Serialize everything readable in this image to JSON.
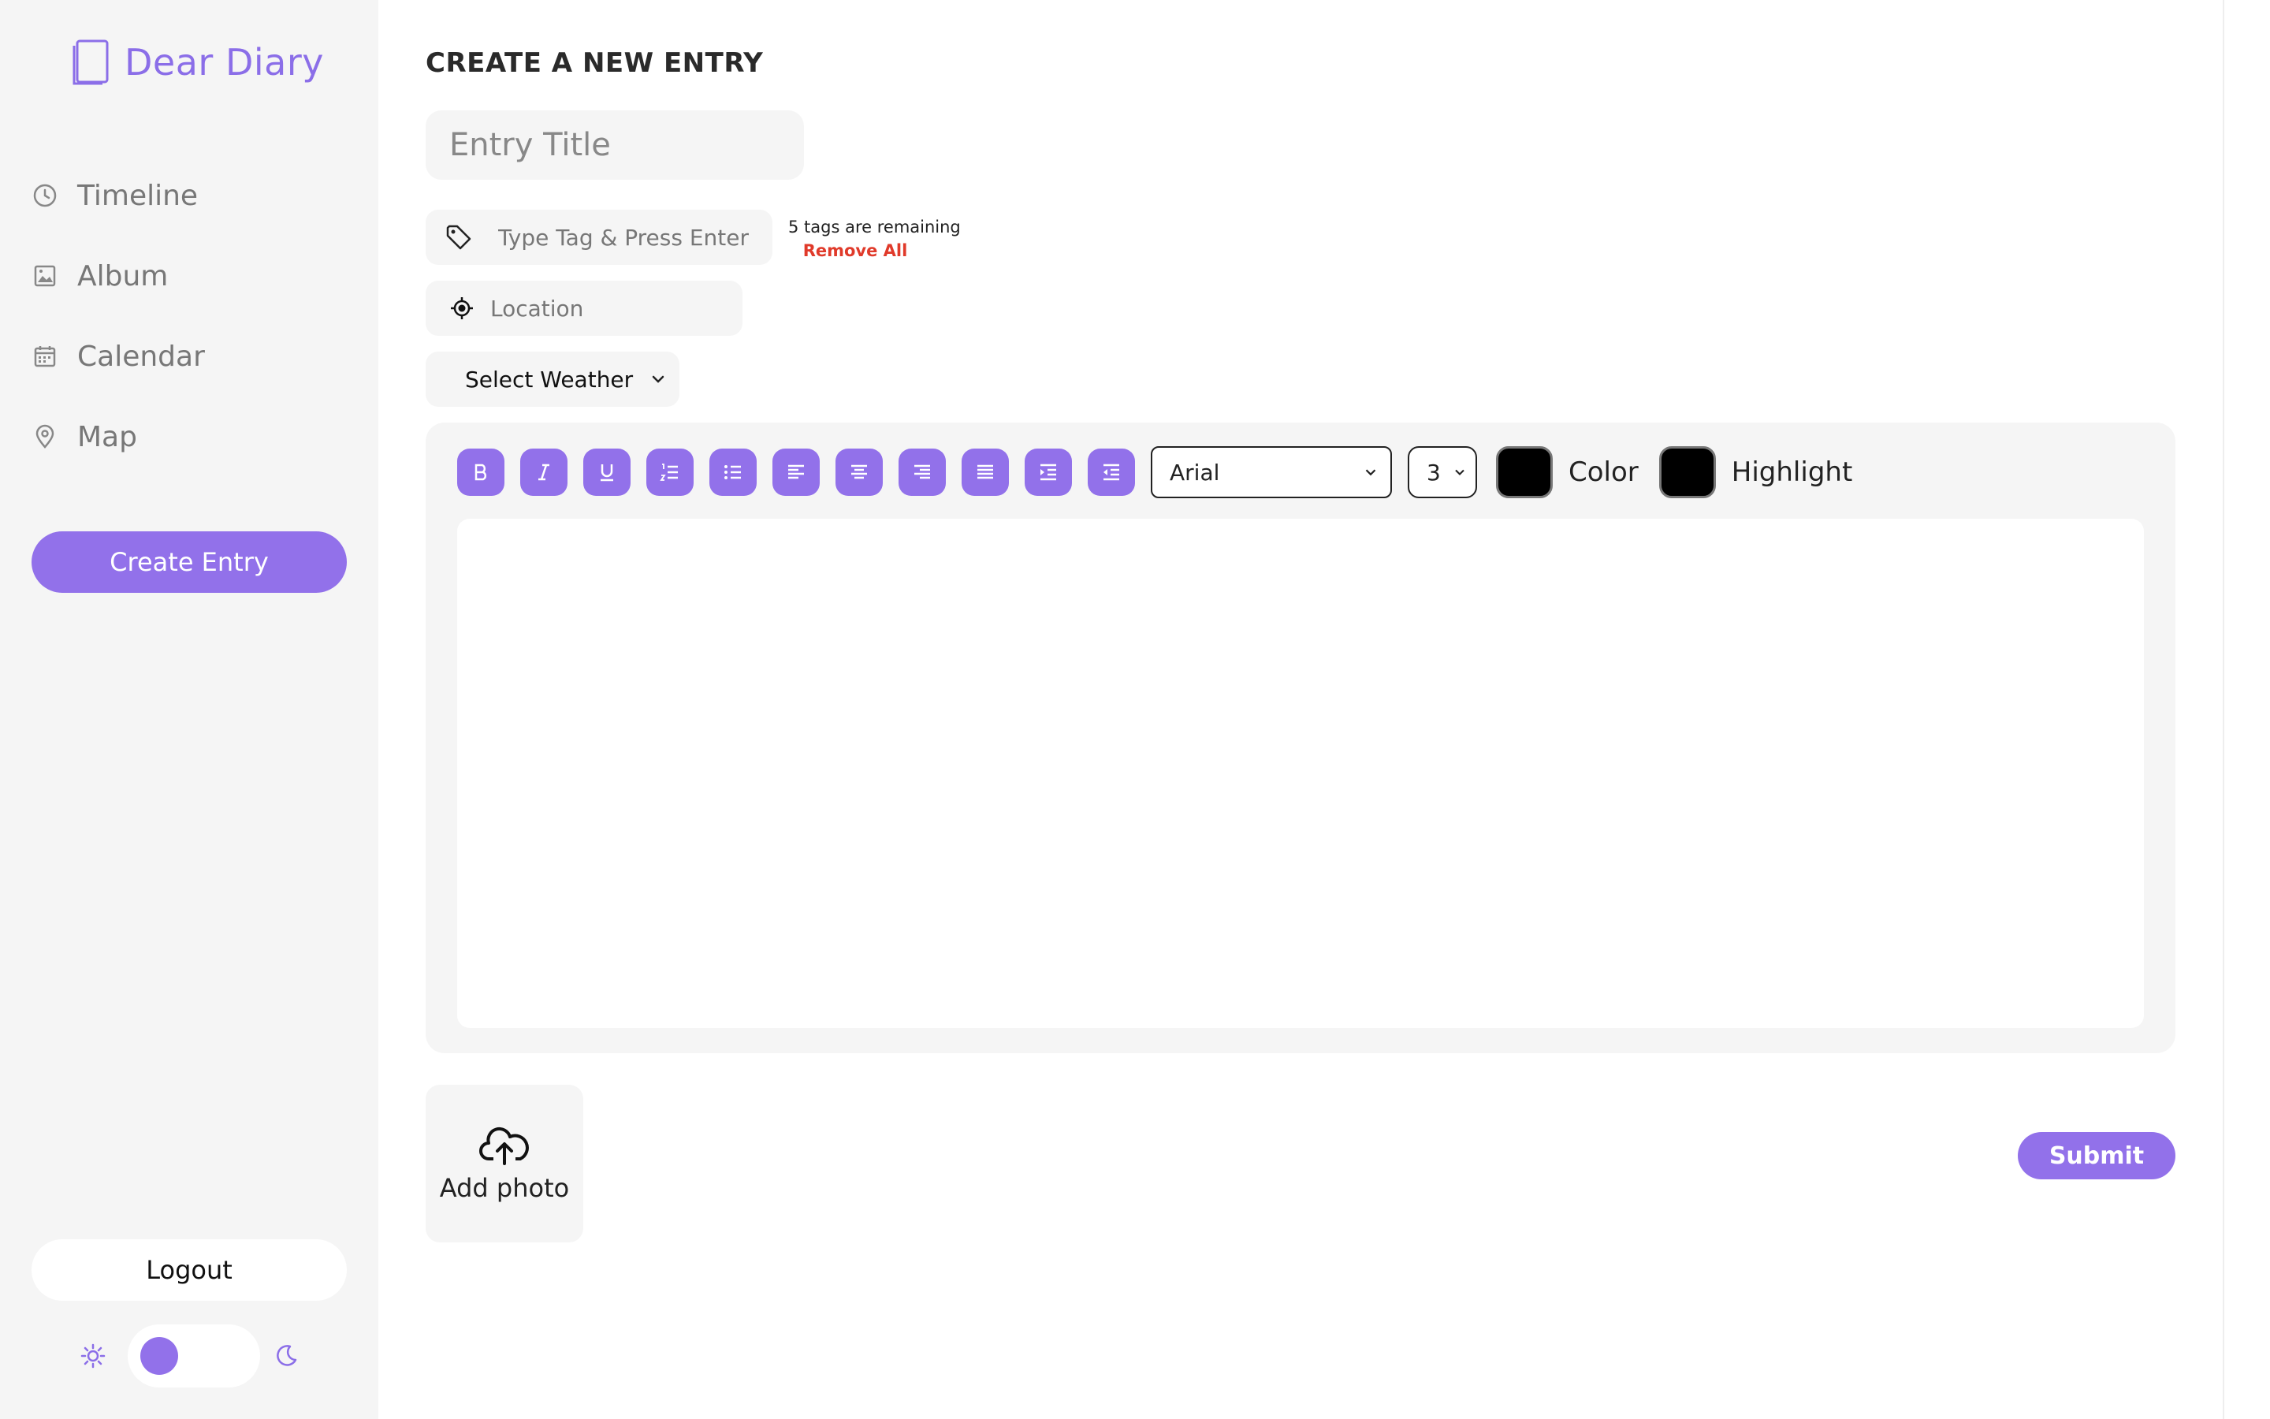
{
  "app": {
    "name": "Dear Diary",
    "accent": "#9271ea",
    "logo_icon": "notebook-icon"
  },
  "sidebar": {
    "items": [
      {
        "label": "Timeline",
        "icon": "clock-icon"
      },
      {
        "label": "Album",
        "icon": "image-icon"
      },
      {
        "label": "Calendar",
        "icon": "calendar-icon"
      },
      {
        "label": "Map",
        "icon": "map-pin-icon"
      }
    ],
    "create_label": "Create Entry",
    "logout_label": "Logout",
    "theme": {
      "light_icon": "sun-icon",
      "dark_icon": "moon-icon",
      "mode": "light"
    }
  },
  "form": {
    "heading": "CREATE A NEW ENTRY",
    "title_placeholder": "Entry Title",
    "tag_placeholder": "Type Tag & Press Enter",
    "tags_remaining": "5 tags are remaining",
    "remove_all": "Remove All",
    "location_placeholder": "Location",
    "weather_label": "Select Weather"
  },
  "toolbar": {
    "buttons": [
      "bold",
      "italic",
      "underline",
      "ordered-list",
      "unordered-list",
      "align-left",
      "align-center",
      "align-right",
      "justify",
      "indent",
      "outdent"
    ],
    "font": "Arial",
    "size": "3",
    "color_label": "Color",
    "highlight_label": "Highlight",
    "color_value": "#000000",
    "highlight_value": "#000000"
  },
  "photo": {
    "label": "Add photo",
    "icon": "cloud-upload-icon"
  },
  "submit_label": "Submit"
}
